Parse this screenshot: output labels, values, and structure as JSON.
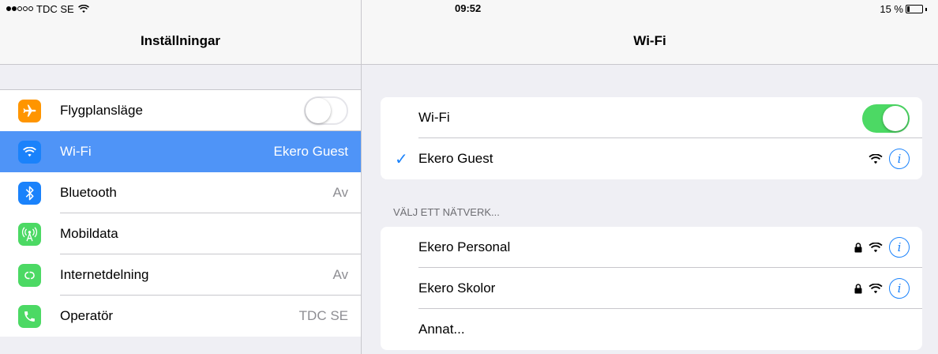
{
  "status_bar": {
    "carrier": "TDC SE",
    "time": "09:52",
    "battery": "15 %",
    "battery_level": 0.15
  },
  "settings": {
    "title": "Inställningar",
    "items": [
      {
        "label": "Flygplansläge",
        "value": "",
        "icon": "airplane-icon",
        "color": "#ff9500"
      },
      {
        "label": "Wi-Fi",
        "value": "Ekero Guest",
        "icon": "wifi-icon",
        "color": "#1a82fb"
      },
      {
        "label": "Bluetooth",
        "value": "Av",
        "icon": "bluetooth-icon",
        "color": "#1a82fb"
      },
      {
        "label": "Mobildata",
        "value": "",
        "icon": "antenna-icon",
        "color": "#4cd964"
      },
      {
        "label": "Internetdelning",
        "value": "Av",
        "icon": "hotspot-icon",
        "color": "#4cd964"
      },
      {
        "label": "Operatör",
        "value": "TDC SE",
        "icon": "phone-icon",
        "color": "#4cd964"
      }
    ]
  },
  "wifi": {
    "title": "Wi-Fi",
    "toggle_label": "Wi-Fi",
    "toggle_on": true,
    "connected_network": "Ekero Guest",
    "section_header": "VÄLJ ETT NÄTVERK...",
    "networks": [
      {
        "name": "Ekero Personal",
        "locked": true
      },
      {
        "name": "Ekero Skolor",
        "locked": true
      }
    ],
    "other": "Annat..."
  },
  "colors": {
    "accent": "#1a82fb",
    "selection": "#4f94f7",
    "toggle_on": "#4cd964"
  }
}
